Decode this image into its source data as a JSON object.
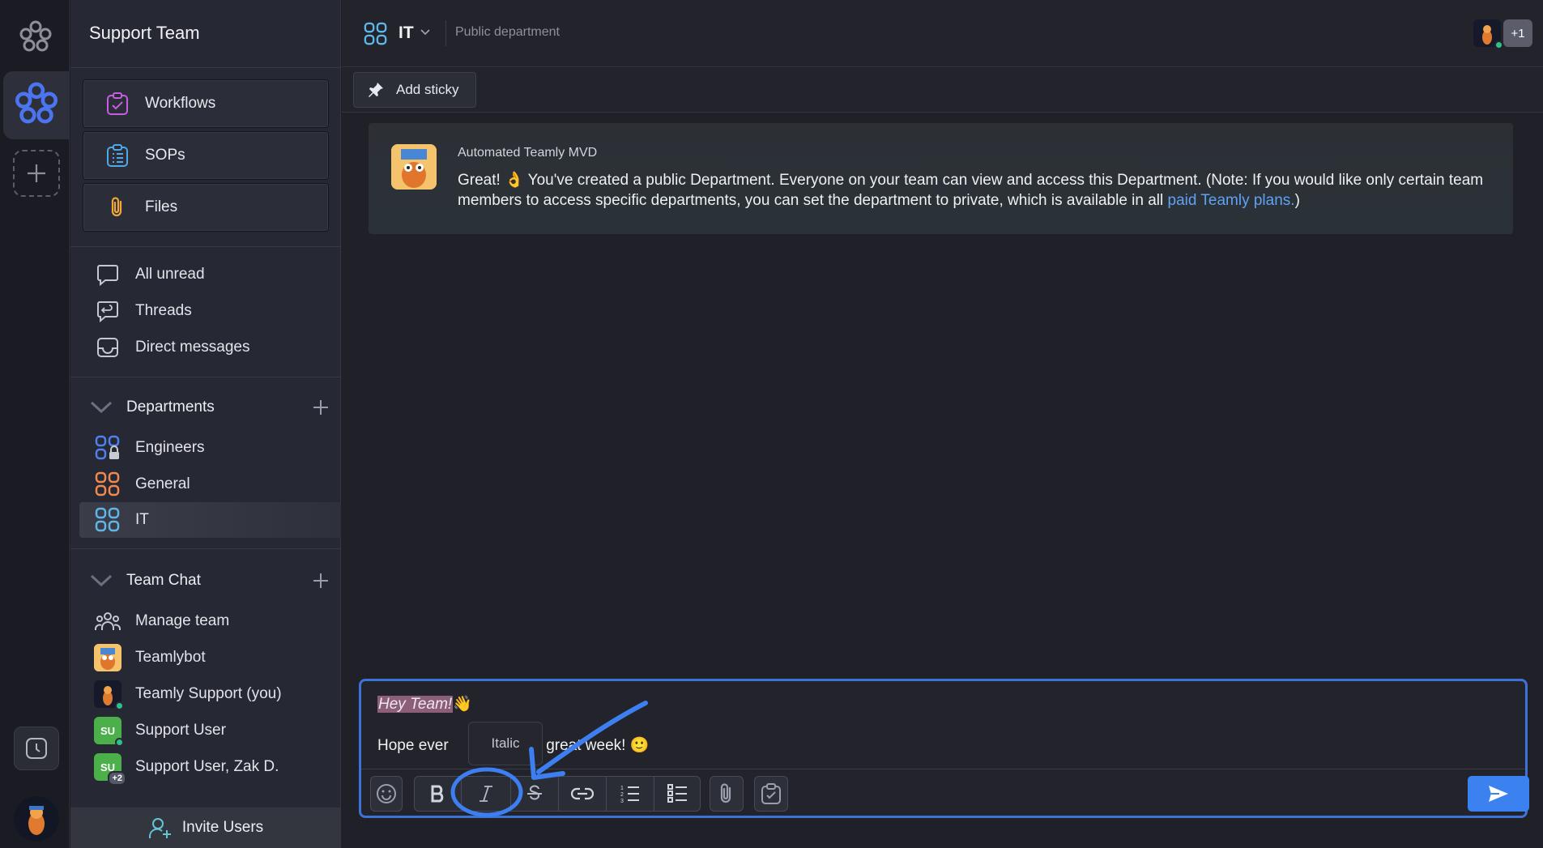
{
  "sidebar": {
    "title": "Support Team",
    "tools": [
      {
        "label": "Workflows",
        "icon": "workflow-check-icon"
      },
      {
        "label": "SOPs",
        "icon": "sop-list-icon"
      },
      {
        "label": "Files",
        "icon": "paperclip-icon"
      }
    ],
    "nav": [
      {
        "label": "All unread",
        "icon": "chat-bubble-icon"
      },
      {
        "label": "Threads",
        "icon": "threads-icon"
      },
      {
        "label": "Direct messages",
        "icon": "inbox-icon"
      }
    ],
    "departments": {
      "header": "Departments",
      "items": [
        {
          "label": "Engineers",
          "color": "#4f7ff0",
          "locked": true
        },
        {
          "label": "General",
          "color": "#f0884f"
        },
        {
          "label": "IT",
          "color": "#5fb7e8",
          "active": true
        }
      ]
    },
    "team_chat": {
      "header": "Team Chat",
      "items": [
        {
          "label": "Manage team"
        },
        {
          "label": "Teamlybot"
        },
        {
          "label": "Teamly Support (you)"
        },
        {
          "label": "Support User",
          "initials": "SU"
        },
        {
          "label": "Support User, Zak D.",
          "initials": "SU",
          "extra": "+2"
        }
      ]
    },
    "invite_label": "Invite Users"
  },
  "header": {
    "channel_name": "IT",
    "description": "Public department",
    "extra_members": "+1"
  },
  "sticky_label": "Add sticky",
  "message": {
    "author": "Automated Teamly MVD",
    "text_before": "Great! 👌 You've created a public Department. Everyone on your team can view and access this Department. (Note: If you would like only certain team members to access specific departments, you can set the department to private, which is available in all ",
    "link_text": "paid Teamly plans.",
    "text_after": ")"
  },
  "composer": {
    "line1_highlight": "Hey Team!",
    "line1_emoji": "👋",
    "line2_start": "Hope ever",
    "line2_end": "aving a great week! 🙂",
    "tooltip": "Italic"
  },
  "colors": {
    "accent": "#3b82f0",
    "annotation": "#3d7ff0"
  }
}
